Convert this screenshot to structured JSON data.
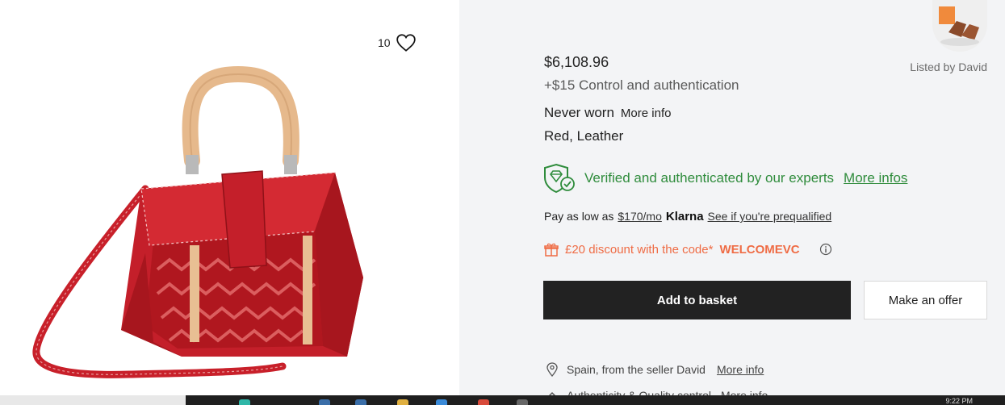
{
  "listing": {
    "like_count": "10",
    "seller_label": "Listed by David",
    "price": "$6,108.96",
    "authentication_fee": "+$15 Control and authentication",
    "condition": "Never worn",
    "condition_more": "More info",
    "color_material": "Red, Leather"
  },
  "verified": {
    "text": "Verified and authenticated by our experts",
    "link": "More infos"
  },
  "klarna": {
    "prefix": "Pay as low as",
    "amount": "$170/mo",
    "brand": "Klarna",
    "link": "See if you're prequalified"
  },
  "discount": {
    "text": "£20 discount with the code*",
    "code": "WELCOMEVC"
  },
  "actions": {
    "add_to_basket": "Add to basket",
    "make_offer": "Make an offer"
  },
  "shipping": {
    "location": "Spain, from the seller David",
    "location_link": "More info",
    "authenticity": "Authenticity & Quality control",
    "authenticity_link": "More info"
  },
  "taskbar": {
    "clock": "9:22 PM"
  },
  "colors": {
    "accent_green": "#2f8c3c",
    "discount_orange": "#ef6c45",
    "primary_button": "#222222",
    "panel_background": "#f3f4f6"
  },
  "icons": [
    "heart-icon",
    "shield-diamond-icon",
    "gift-icon",
    "info-icon",
    "location-pin-icon",
    "chevron-icon"
  ]
}
